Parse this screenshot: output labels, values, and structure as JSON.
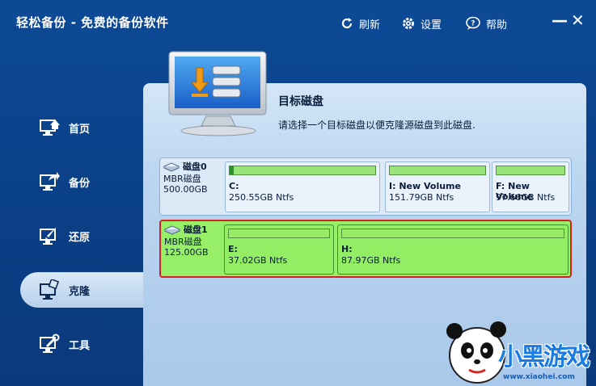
{
  "app": {
    "title": "轻松备份 - 免费的备份软件"
  },
  "toolbar": {
    "refresh": "刷新",
    "settings": "设置",
    "help": "帮助",
    "minimize": "—",
    "close": "✕"
  },
  "sidebar": {
    "items": [
      {
        "label": "首页",
        "icon": "home-monitor-icon"
      },
      {
        "label": "备份",
        "icon": "backup-monitor-icon"
      },
      {
        "label": "还原",
        "icon": "restore-monitor-icon"
      },
      {
        "label": "克隆",
        "icon": "clone-monitor-icon",
        "active": true
      },
      {
        "label": "工具",
        "icon": "tools-monitor-icon"
      }
    ]
  },
  "header": {
    "title": "目标磁盘",
    "subtitle": "请选择一个目标磁盘以便克隆源磁盘到此磁盘."
  },
  "disks": [
    {
      "name": "磁盘0",
      "type": "MBR磁盘",
      "size": "500.00GB",
      "selected": false,
      "partitions": [
        {
          "label": "C:",
          "size": "250.55GB Ntfs",
          "used_fraction": 0.03
        },
        {
          "label": "I: New Volume",
          "size": "151.79GB Ntfs",
          "used_fraction": 0.0
        },
        {
          "label": "F: New Volume",
          "size": "97.66GB Ntfs",
          "used_fraction": 0.0
        }
      ]
    },
    {
      "name": "磁盘1",
      "type": "MBR磁盘",
      "size": "125.00GB",
      "selected": true,
      "partitions": [
        {
          "label": "E:",
          "size": "37.02GB Ntfs",
          "used_fraction": 0.0
        },
        {
          "label": "H:",
          "size": "87.97GB Ntfs",
          "used_fraction": 0.0
        }
      ]
    }
  ],
  "watermark": {
    "brand": "小黑游戏",
    "url": "www.xiaohei.com"
  },
  "colors": {
    "window_bg": "#0d4a96",
    "panel_bg": "#bcd6f0",
    "selected_border": "#d81f1f",
    "selected_bg": "#96ef66"
  }
}
